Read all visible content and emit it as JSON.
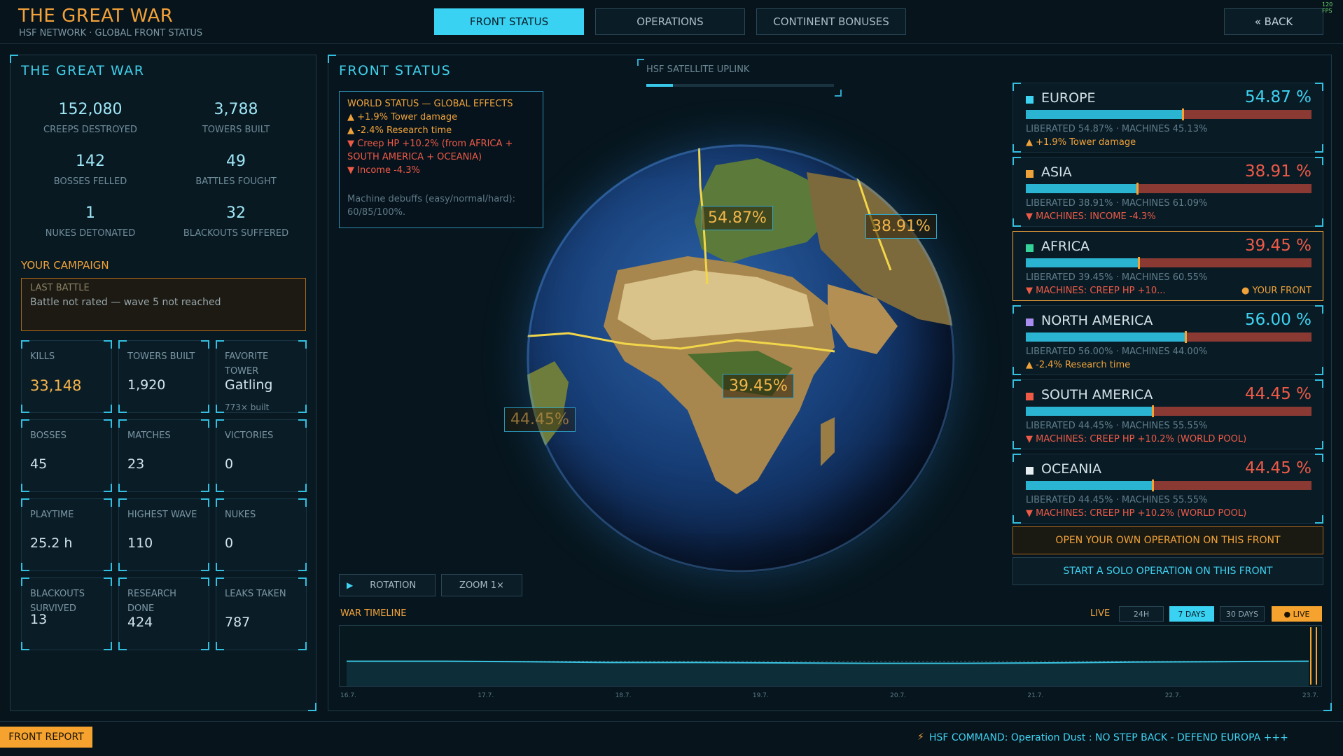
{
  "header": {
    "title": "THE GREAT WAR",
    "subtitle": "HSF NETWORK · GLOBAL FRONT STATUS",
    "tabs": [
      {
        "label": "FRONT STATUS"
      },
      {
        "label": "OPERATIONS"
      },
      {
        "label": "CONTINENT BONUSES"
      }
    ],
    "back_label": "« BACK",
    "fps": "120 FPS"
  },
  "left_panel": {
    "title": "THE GREAT WAR",
    "stats": [
      {
        "value": "152,080",
        "label": "CREEPS DESTROYED"
      },
      {
        "value": "3,788",
        "label": "TOWERS BUILT"
      },
      {
        "value": "142",
        "label": "BOSSES FELLED"
      },
      {
        "value": "49",
        "label": "BATTLES FOUGHT"
      },
      {
        "value": "1",
        "label": "NUKES DETONATED"
      },
      {
        "value": "32",
        "label": "BLACKOUTS SUFFERED"
      }
    ],
    "campaign_title": "YOUR CAMPAIGN",
    "last_battle": {
      "label": "LAST BATTLE",
      "text": "Battle not rated — wave 5 not reached"
    },
    "tiles": [
      {
        "label": "KILLS",
        "value": "33,148",
        "sub": ""
      },
      {
        "label": "TOWERS BUILT",
        "value": "1,920",
        "sub": ""
      },
      {
        "label": "FAVORITE TOWER",
        "value": "Gatling",
        "sub": "773× built"
      },
      {
        "label": "BOSSES",
        "value": "45",
        "sub": ""
      },
      {
        "label": "MATCHES",
        "value": "23",
        "sub": ""
      },
      {
        "label": "VICTORIES",
        "value": "0",
        "sub": ""
      },
      {
        "label": "PLAYTIME",
        "value": "25.2 h",
        "sub": ""
      },
      {
        "label": "HIGHEST WAVE",
        "value": "110",
        "sub": ""
      },
      {
        "label": "NUKES",
        "value": "0",
        "sub": ""
      },
      {
        "label": "BLACKOUTS SURVIVED",
        "value": "13",
        "sub": ""
      },
      {
        "label": "RESEARCH DONE",
        "value": "424",
        "sub": ""
      },
      {
        "label": "LEAKS TAKEN",
        "value": "787",
        "sub": ""
      }
    ]
  },
  "center": {
    "title": "FRONT STATUS",
    "uplink_label": "HSF SATELLITE UPLINK",
    "uplink_progress": 0.14,
    "world_status": {
      "title": "WORLD STATUS — GLOBAL EFFECTS",
      "lines": [
        {
          "text": "▲ +1.9% Tower damage",
          "tone": "orange"
        },
        {
          "text": "▲ -2.4% Research time",
          "tone": "orange"
        },
        {
          "text": "▼ Creep HP +10.2% (from AFRICA + SOUTH AMERICA + OCEANIA)",
          "tone": "red"
        },
        {
          "text": "▼ Income -4.3%",
          "tone": "red"
        }
      ],
      "footnote": "Machine debuffs (easy/normal/hard): 60/85/100%."
    },
    "globe_labels": [
      {
        "text": "54.87%"
      },
      {
        "text": "38.91%"
      },
      {
        "text": "39.45%"
      },
      {
        "text": "44.45%"
      }
    ],
    "controls": {
      "rotation": "ROTATION",
      "zoom": "ZOOM 1×"
    },
    "timeline": {
      "title": "WAR TIMELINE",
      "live_label": "LIVE",
      "ranges": [
        "24H",
        "7 DAYS",
        "30 DAYS",
        "● LIVE"
      ],
      "selected_range": "7 DAYS",
      "ticks": [
        "16.7.",
        "17.7.",
        "18.7.",
        "19.7.",
        "20.7.",
        "21.7.",
        "22.7.",
        "23.7."
      ],
      "values": [
        54.9,
        54.9,
        54.8,
        54.6,
        54.6,
        54.5,
        54.4,
        54.4,
        54.5,
        54.7,
        54.8,
        54.9
      ]
    }
  },
  "regions": [
    {
      "name": "EUROPE",
      "pct": "54.87 %",
      "liberated": 54.87,
      "lib_text": "LIBERATED 54.87% · MACHINES 45.13%",
      "effect": "▲ +1.9% Tower damage",
      "effect_tone": "orange",
      "color": "#3fd3f2",
      "pct_tone": "cyan",
      "your_front": ""
    },
    {
      "name": "ASIA",
      "pct": "38.91 %",
      "liberated": 38.91,
      "lib_text": "LIBERATED 38.91% · MACHINES 61.09%",
      "effect": "▼ MACHINES: INCOME -4.3%",
      "effect_tone": "red",
      "color": "#f0a23a",
      "pct_tone": "red",
      "your_front": ""
    },
    {
      "name": "AFRICA",
      "pct": "39.45 %",
      "liberated": 39.45,
      "lib_text": "LIBERATED 39.45% · MACHINES 60.55%",
      "effect": "▼ MACHINES: CREEP HP +10...",
      "effect_tone": "red",
      "color": "#35d39a",
      "pct_tone": "red",
      "your_front": "● YOUR FRONT"
    },
    {
      "name": "NORTH AMERICA",
      "pct": "56.00 %",
      "liberated": 56.0,
      "lib_text": "LIBERATED 56.00% · MACHINES 44.00%",
      "effect": "▲ -2.4% Research time",
      "effect_tone": "orange",
      "color": "#a98df0",
      "pct_tone": "cyan",
      "your_front": ""
    },
    {
      "name": "SOUTH AMERICA",
      "pct": "44.45 %",
      "liberated": 44.45,
      "lib_text": "LIBERATED 44.45% · MACHINES 55.55%",
      "effect": "▼ MACHINES: CREEP HP +10.2% (WORLD POOL)",
      "effect_tone": "red",
      "color": "#ef5a47",
      "pct_tone": "red",
      "your_front": ""
    },
    {
      "name": "OCEANIA",
      "pct": "44.45 %",
      "liberated": 44.45,
      "lib_text": "LIBERATED 44.45% · MACHINES 55.55%",
      "effect": "▼ MACHINES: CREEP HP +10.2% (WORLD POOL)",
      "effect_tone": "red",
      "color": "#e6eef2",
      "pct_tone": "red",
      "your_front": ""
    }
  ],
  "actions": {
    "open_operation": "OPEN YOUR OWN OPERATION ON THIS FRONT",
    "solo_operation": "START A SOLO OPERATION ON THIS FRONT"
  },
  "footer": {
    "front_report": "FRONT REPORT",
    "ticker": "HSF COMMAND: Operation Dust : NO STEP BACK - DEFEND EUROPA   +++"
  }
}
